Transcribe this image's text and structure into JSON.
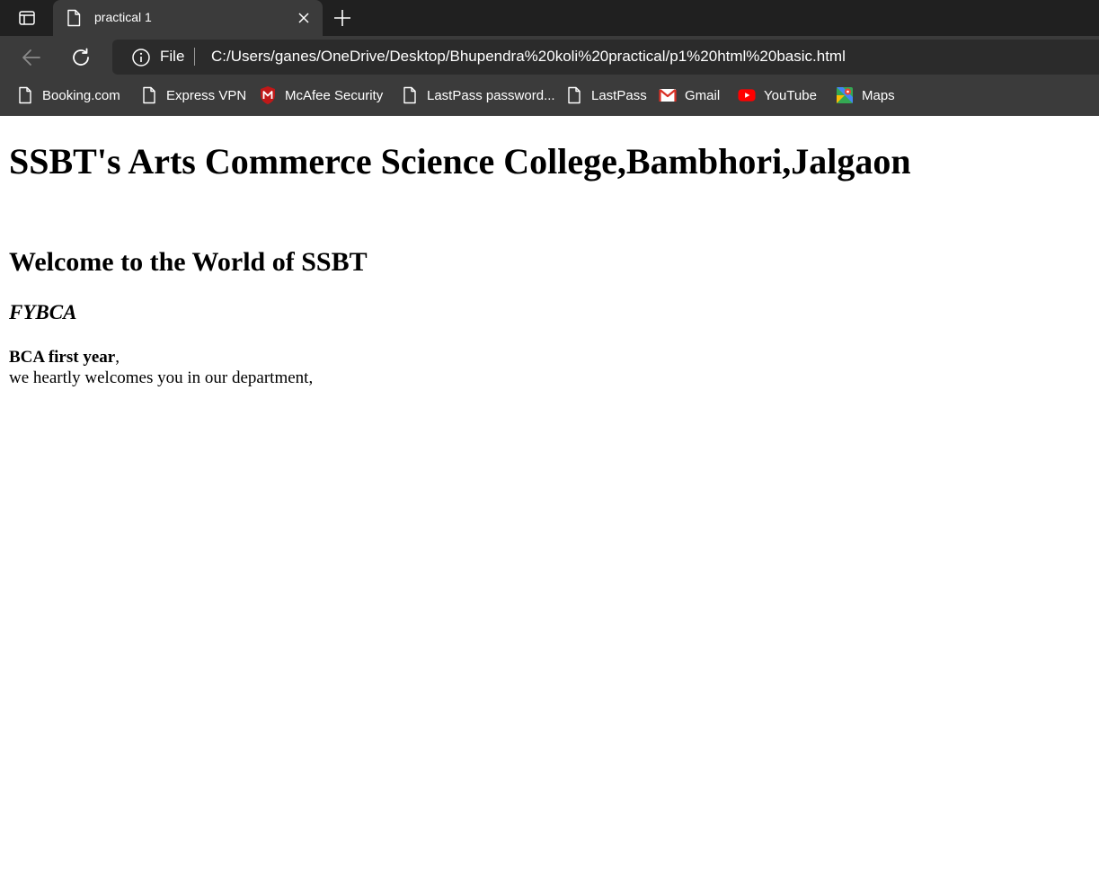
{
  "browser": {
    "tab": {
      "title": "practical 1"
    },
    "address_bar": {
      "scheme_label": "File",
      "url": "C:/Users/ganes/OneDrive/Desktop/Bhupendra%20koli%20practical/p1%20html%20basic.html"
    },
    "bookmarks": [
      {
        "label": "Booking.com",
        "icon": "page-icon"
      },
      {
        "label": "Express VPN",
        "icon": "page-icon"
      },
      {
        "label": "McAfee Security",
        "icon": "mcafee-icon"
      },
      {
        "label": "LastPass password...",
        "icon": "page-icon"
      },
      {
        "label": "LastPass",
        "icon": "page-icon"
      },
      {
        "label": "Gmail",
        "icon": "gmail-icon"
      },
      {
        "label": "YouTube",
        "icon": "youtube-icon"
      },
      {
        "label": "Maps",
        "icon": "maps-icon"
      }
    ]
  },
  "page": {
    "heading1": "SSBT's Arts Commerce Science College,Bambhori,Jalgaon",
    "heading2": "Welcome to the World of SSBT",
    "heading3": "FYBCA",
    "bold_text": "BCA first year",
    "bold_suffix": ",",
    "paragraph": "we heartly welcomes you in our department,"
  },
  "colors": {
    "tabstrip": "#202020",
    "toolbar": "#3b3b3b",
    "omnibox": "#2b2b2b",
    "page_background": "#ffffff"
  }
}
